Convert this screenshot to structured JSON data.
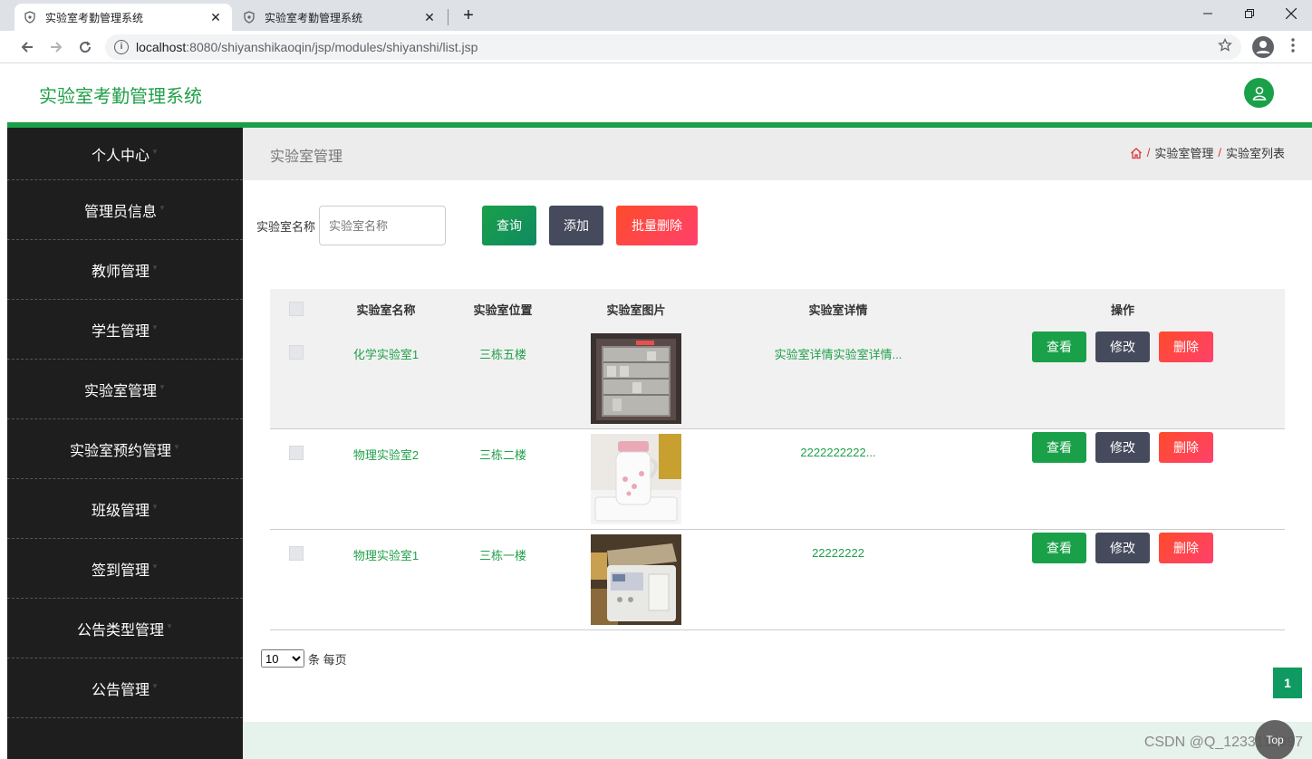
{
  "browser": {
    "tabs": [
      {
        "title": "实验室考勤管理系统",
        "active": true
      },
      {
        "title": "实验室考勤管理系统",
        "active": false
      }
    ],
    "close_glyph": "✕",
    "new_tab_glyph": "+",
    "url_host": "localhost",
    "url_path": ":8080/shiyanshikaoqin/jsp/modules/shiyanshi/list.jsp",
    "info_glyph": "i"
  },
  "app": {
    "title": "实验室考勤管理系统",
    "brand_color": "#1aa048"
  },
  "sidebar": {
    "items": [
      {
        "label": "个人中心"
      },
      {
        "label": "管理员信息"
      },
      {
        "label": "教师管理"
      },
      {
        "label": "学生管理"
      },
      {
        "label": "实验室管理"
      },
      {
        "label": "实验室预约管理"
      },
      {
        "label": "班级管理"
      },
      {
        "label": "签到管理"
      },
      {
        "label": "公告类型管理"
      },
      {
        "label": "公告管理"
      }
    ]
  },
  "page": {
    "title": "实验室管理",
    "breadcrumb": [
      "实验室管理",
      "实验室列表"
    ],
    "breadcrumb_sep": "/"
  },
  "search": {
    "label": "实验室名称",
    "placeholder": "实验室名称",
    "query_label": "查询",
    "add_label": "添加",
    "batch_delete_label": "批量删除"
  },
  "table": {
    "headers": [
      "实验室名称",
      "实验室位置",
      "实验室图片",
      "实验室详情",
      "操作"
    ],
    "rows": [
      {
        "name": "化学实验室1",
        "location": "三栋五楼",
        "image": "fridge-photo",
        "detail": "实验室详情实验室详情..."
      },
      {
        "name": "物理实验室2",
        "location": "三栋二楼",
        "image": "kettle-photo",
        "detail": "2222222222..."
      },
      {
        "name": "物理实验室1",
        "location": "三栋一楼",
        "image": "breadmaker-photo",
        "detail": "22222222"
      }
    ],
    "view_label": "查看",
    "edit_label": "修改",
    "delete_label": "删除"
  },
  "pagination": {
    "page_size": "10",
    "suffix": "条 每页",
    "current_page": "1"
  },
  "footer": {
    "watermark": "CSDN @Q_1233112997",
    "top_label": "Top"
  }
}
